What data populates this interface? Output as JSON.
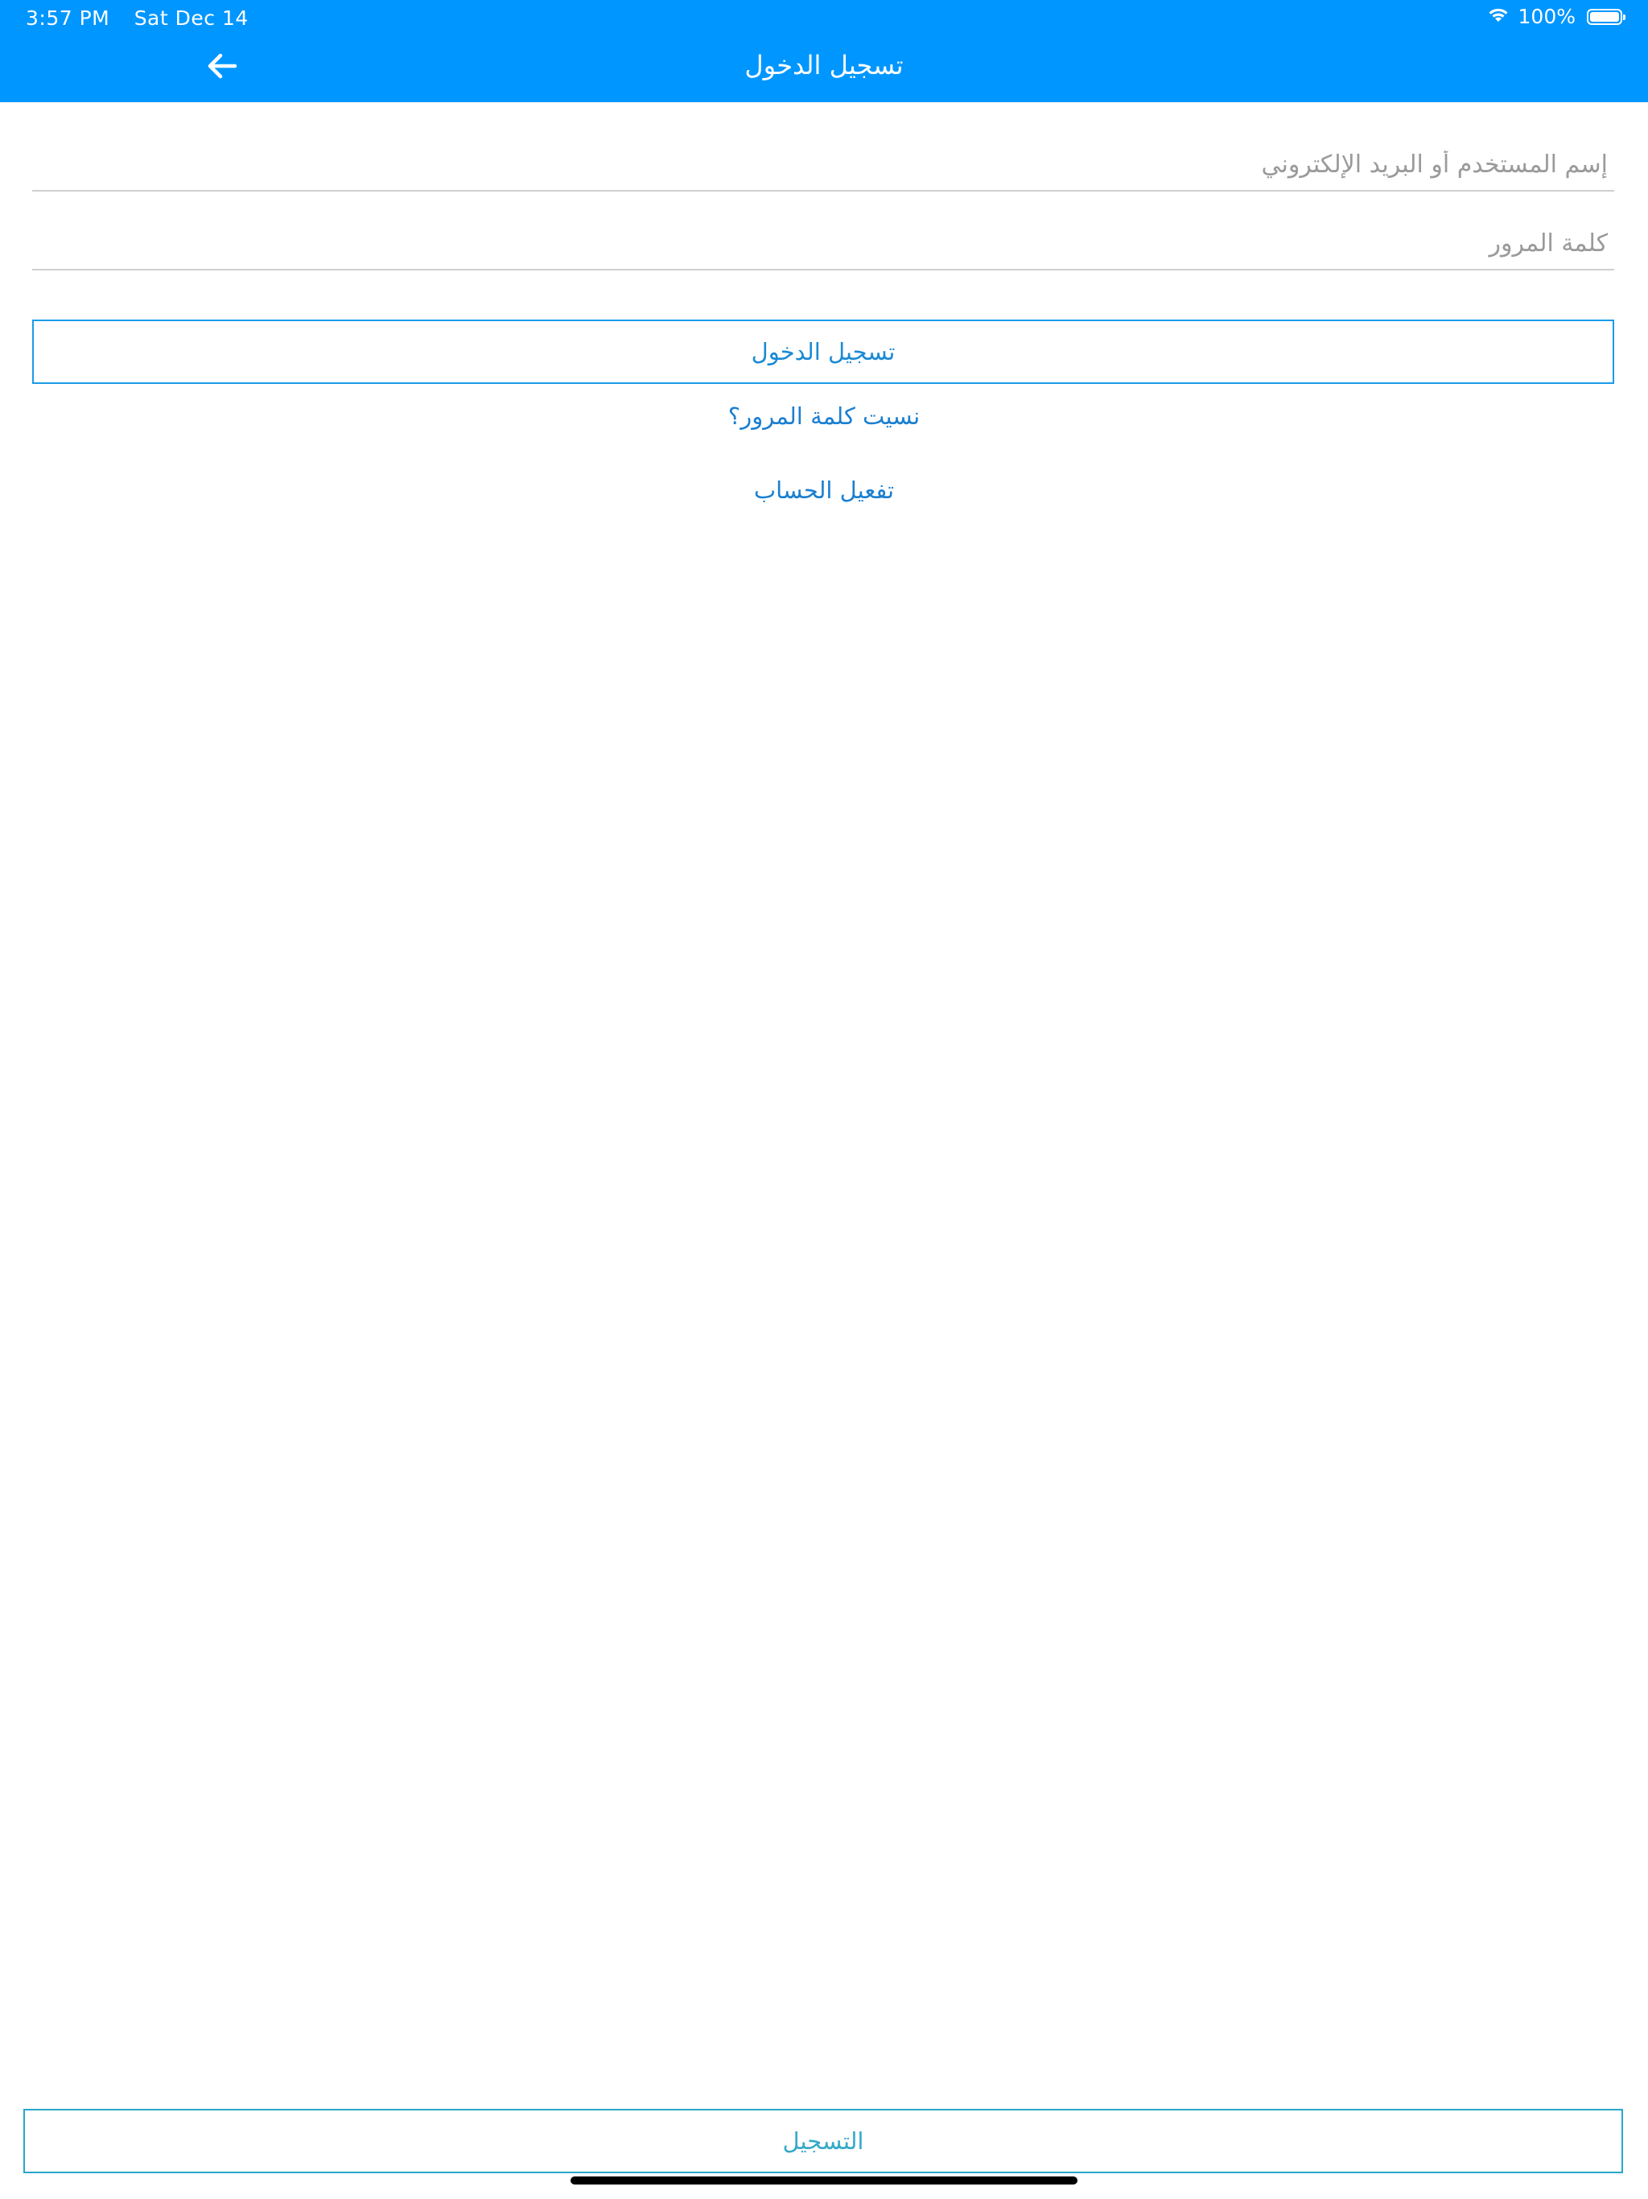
{
  "status_bar": {
    "time": "3:57 PM",
    "date": "Sat Dec 14",
    "battery": "100%",
    "battery_level": 1.0,
    "wifi_icon": "wifi-icon",
    "battery_icon": "battery-icon"
  },
  "header": {
    "title": "تسجيل الدخول",
    "back_icon": "arrow-left-icon"
  },
  "form": {
    "username_placeholder": "إسم المستخدم أو البريد الإلكتروني",
    "username_value": "",
    "password_placeholder": "كلمة المرور",
    "password_value": "",
    "login_label": "تسجيل الدخول",
    "forgot_label": "نسيت كلمة المرور؟",
    "activate_label": "تفعيل الحساب"
  },
  "footer": {
    "register_label": "التسجيل"
  },
  "colors": {
    "header_bg": "#0096ff",
    "accent": "#1a9be8",
    "register_accent": "#2aa7c9"
  }
}
